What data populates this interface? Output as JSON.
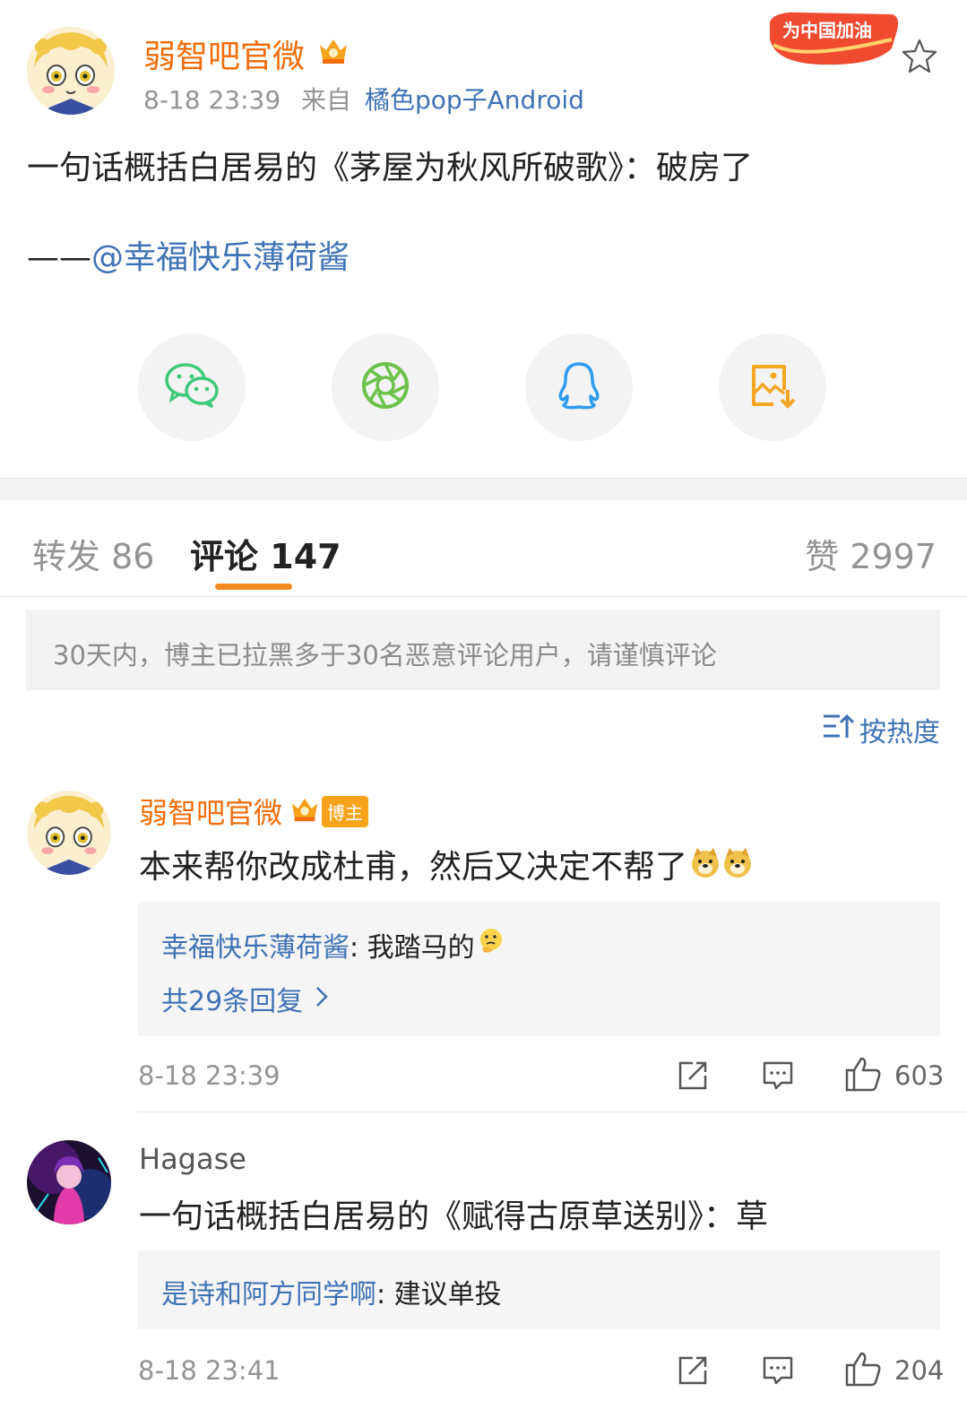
{
  "post": {
    "username": "弱智吧官微",
    "time": "8-18 23:39",
    "source_prefix": "来自",
    "source": "橘色pop子Android",
    "badge_text": "为中国加油",
    "content_line1": "一句话概括白居易的《茅屋为秋风所破歌》：破房了",
    "content_dash": "——",
    "content_mention": "@幸福快乐薄荷酱"
  },
  "share": {
    "icons": [
      "wechat-icon",
      "moments-icon",
      "qq-icon",
      "save-image-icon"
    ]
  },
  "tabs": {
    "repost_label": "转发",
    "repost_count": "86",
    "comment_label": "评论",
    "comment_count": "147",
    "like_label": "赞",
    "like_count": "2997"
  },
  "notice": "30天内，博主已拉黑多于30名恶意评论用户，请谨慎评论",
  "sort_label": "按热度",
  "comments": [
    {
      "username": "弱智吧官微",
      "tag": "博主",
      "text": "本来帮你改成杜甫，然后又决定不帮了",
      "reply_user": "幸福快乐薄荷酱",
      "reply_text": ": 我踏马的",
      "more_replies": "共29条回复",
      "time": "8-18 23:39",
      "likes": "603"
    },
    {
      "username": "Hagase",
      "text": "一句话概括白居易的《赋得古原草送别》：草",
      "reply_user": "是诗和阿方同学啊",
      "reply_text": ": 建议单投",
      "time": "8-18 23:41",
      "likes": "204"
    }
  ],
  "colors": {
    "name_orange": "#f26d0a",
    "link_blue": "#3f72b5",
    "tab_underline": "#f58a1f",
    "grey_text": "#939393",
    "wechat_green": "#3ec97a",
    "qq_blue": "#2d9cf0",
    "save_orange": "#f5a623"
  }
}
